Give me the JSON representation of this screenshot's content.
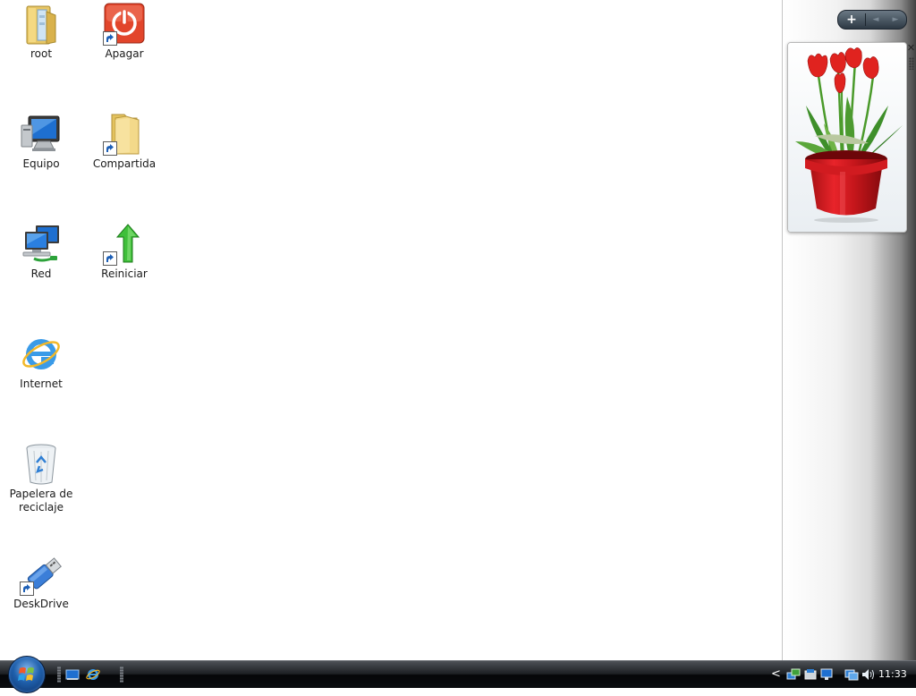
{
  "desktop": {
    "icons": [
      {
        "label": "root",
        "icon": "user-folder-icon"
      },
      {
        "label": "Apagar",
        "icon": "power-icon"
      },
      {
        "label": "Equipo",
        "icon": "computer-icon"
      },
      {
        "label": "Compartida",
        "icon": "folder-icon"
      },
      {
        "label": "Red",
        "icon": "network-icon"
      },
      {
        "label": "Reiniciar",
        "icon": "restart-arrow-icon"
      },
      {
        "label": "Internet",
        "icon": "internet-explorer-icon"
      },
      {
        "label": "Papelera de reciclaje",
        "icon": "recycle-bin-icon"
      },
      {
        "label": "DeskDrive",
        "icon": "usb-drive-icon"
      }
    ]
  },
  "sidebar": {
    "add_gadget_label": "+",
    "prev_label": "◄",
    "next_label": "►",
    "gadget": {
      "name": "slideshow-gadget",
      "close_label": "✕"
    }
  },
  "taskbar": {
    "tray_chevron": "<",
    "clock": "11:33"
  },
  "colors": {
    "taskbar": "#0b0d10",
    "desktop": "#ffffff",
    "sidebar_accent": "#3c3c3c"
  }
}
